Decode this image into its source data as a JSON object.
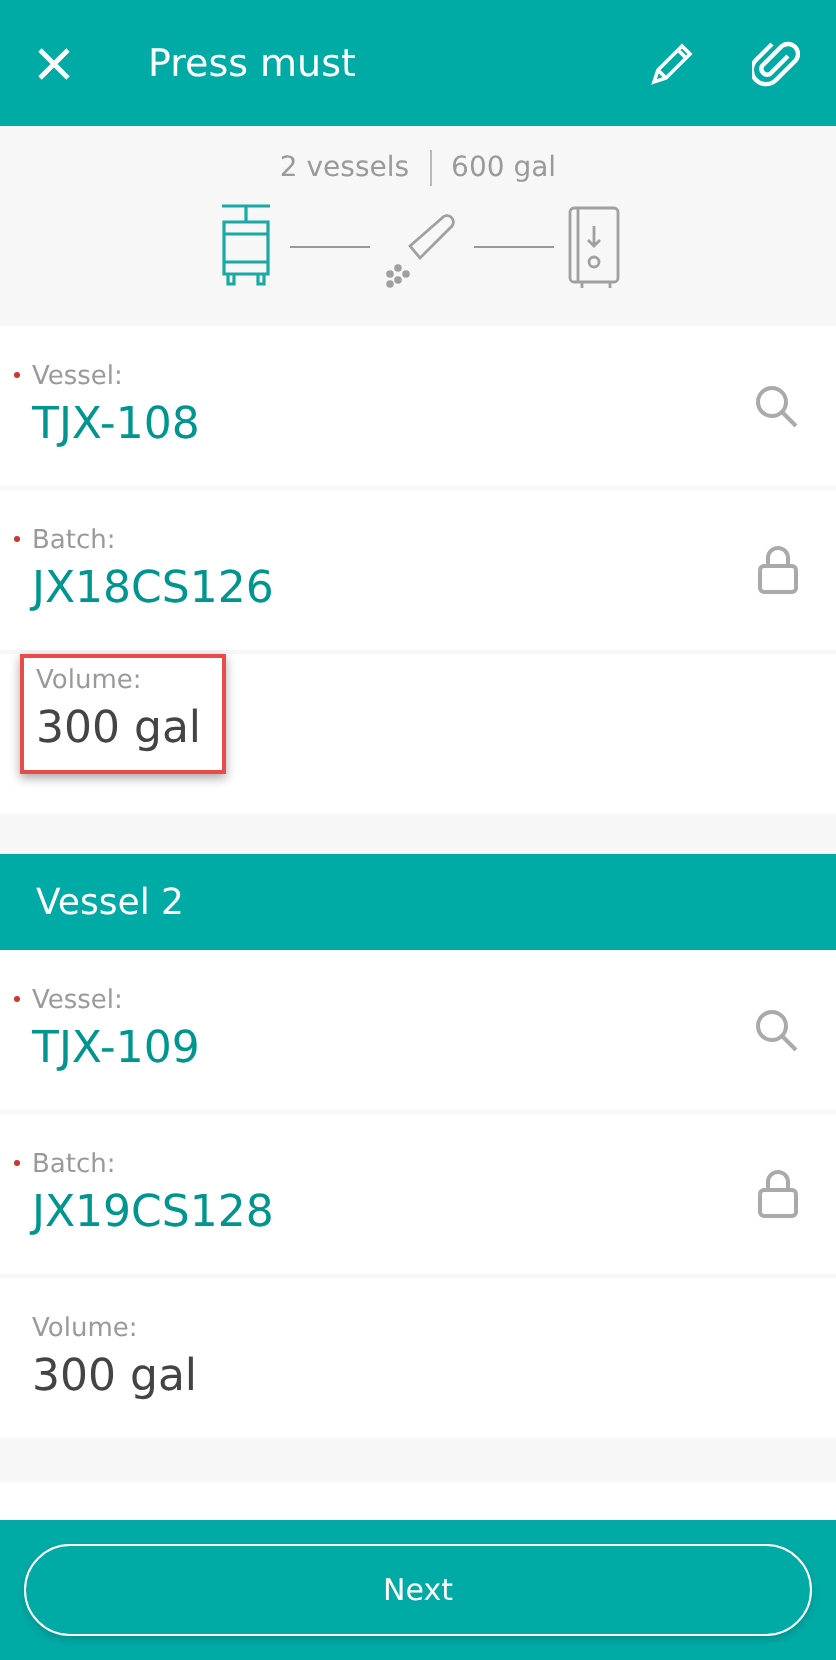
{
  "header": {
    "title": "Press must"
  },
  "summary": {
    "vessels": "2 vessels",
    "volume": "600 gal",
    "steps": [
      {
        "kind": "press",
        "selected": true
      },
      {
        "kind": "additive",
        "selected": false
      },
      {
        "kind": "tank",
        "selected": false
      }
    ]
  },
  "groups": [
    {
      "fields": [
        {
          "label": "Vessel:",
          "value": "TJX-108",
          "required": true,
          "kind": "search",
          "highlighted": false
        },
        {
          "label": "Batch:",
          "value": "JX18CS126",
          "required": true,
          "kind": "locked",
          "highlighted": false
        },
        {
          "label": "Volume:",
          "value": "300 gal",
          "required": false,
          "kind": "plain",
          "highlighted": true
        }
      ]
    },
    {
      "title": "Vessel 2",
      "fields": [
        {
          "label": "Vessel:",
          "value": "TJX-109",
          "required": true,
          "kind": "search",
          "highlighted": false
        },
        {
          "label": "Batch:",
          "value": "JX19CS128",
          "required": true,
          "kind": "locked",
          "highlighted": false
        },
        {
          "label": "Volume:",
          "value": "300 gal",
          "required": false,
          "kind": "plain",
          "highlighted": false
        }
      ]
    }
  ],
  "footer": {
    "button": "Next"
  }
}
